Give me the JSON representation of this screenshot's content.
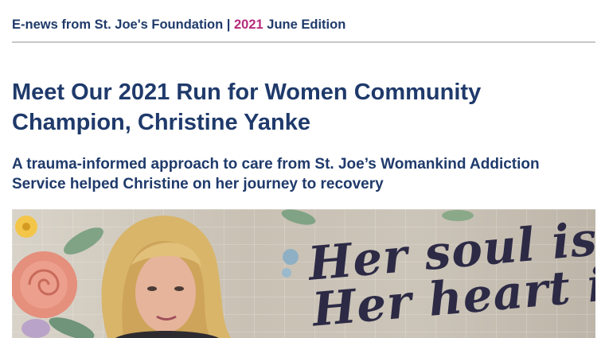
{
  "header": {
    "prefix": "E-news from St. Joe's Foundation | ",
    "year": "2021",
    "edition": " June Edition"
  },
  "article": {
    "title": "Meet Our 2021 Run for Women Community Champion, Christine Yanke",
    "subtitle": "A trauma-informed approach to care from St. Joe’s Womankind Addiction Service helped Christine on her journey to recovery"
  },
  "hero_image": {
    "mural_text": "Her soul is\nHer heart is"
  },
  "colors": {
    "heading": "#1f3a6b",
    "accent": "#b52a7a",
    "divider": "#c8c8c8"
  }
}
